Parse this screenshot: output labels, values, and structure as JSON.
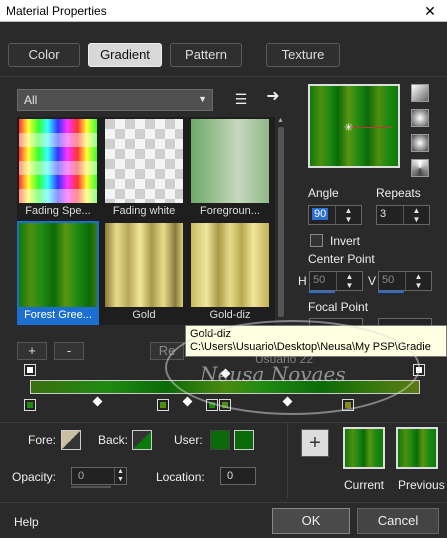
{
  "window": {
    "title": "Material Properties",
    "close_glyph": "✕"
  },
  "tabs": [
    {
      "label": "Color",
      "active": false
    },
    {
      "label": "Gradient",
      "active": true
    },
    {
      "label": "Pattern",
      "active": false
    },
    {
      "label": "Texture",
      "active": false
    }
  ],
  "category": {
    "selected": "All"
  },
  "gradients": [
    {
      "label": "Fading Spe...",
      "selected": false
    },
    {
      "label": "Fading white",
      "selected": false
    },
    {
      "label": "Foregroun...",
      "selected": false
    },
    {
      "label": "Forest Gree...",
      "selected": true
    },
    {
      "label": "Gold",
      "selected": false
    },
    {
      "label": "Gold-diz",
      "selected": false
    }
  ],
  "gradient_buttons": {
    "add": "+",
    "remove": "-",
    "reset_partial": "Re"
  },
  "tooltip": {
    "name": "Gold-diz",
    "path": "C:\\Users\\Usuario\\Desktop\\Neusa\\My PSP\\Gradie"
  },
  "angle": {
    "label": "Angle",
    "value": "90"
  },
  "repeats": {
    "label": "Repeats",
    "value": "3"
  },
  "invert": {
    "label": "Invert",
    "checked": false
  },
  "center_point": {
    "label": "Center Point",
    "h_label": "H",
    "h_value": "50",
    "v_label": "V",
    "v_value": "50"
  },
  "focal_point": {
    "label": "Focal Point"
  },
  "watermark": {
    "line1": "Neusa Novaes",
    "line2": "Usuário 22"
  },
  "materials": {
    "fore_label": "Fore:",
    "back_label": "Back:",
    "user_label": "User:",
    "opacity_label": "Opacity:",
    "opacity_value": "0",
    "location_label": "Location:",
    "location_value": "0"
  },
  "comparison": {
    "add": "+",
    "current_label": "Current",
    "previous_label": "Previous"
  },
  "footer": {
    "help": "Help",
    "ok": "OK",
    "cancel": "Cancel"
  },
  "colors": {
    "accent": "#1c6fd0",
    "forest_green": "#0b6a08",
    "user_swatch": "#0a6a0a"
  }
}
